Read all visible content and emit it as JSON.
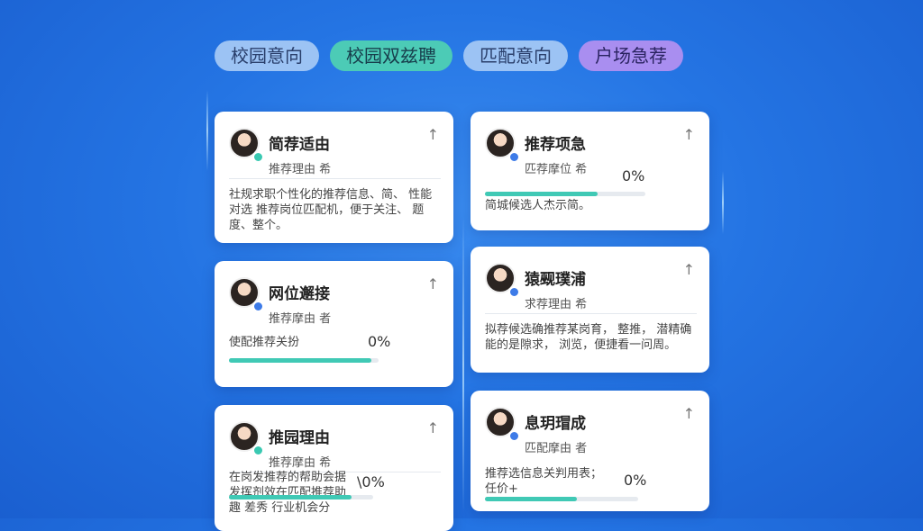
{
  "tabs": [
    {
      "label": "校园意向"
    },
    {
      "label": "校园双兹聘"
    },
    {
      "label": "匹配意向"
    },
    {
      "label": "户场急荐"
    }
  ],
  "cards": [
    {
      "title": "简荐适由",
      "sub": "推荐理由 希",
      "body": "社规求职个性化的推荐信息、简、 性能对选  推荐岗位匹配机，便于关注、 题度、整个。",
      "status_color": "#3ac9b2"
    },
    {
      "title": "推荐项急",
      "sub": "匹荐摩位 希",
      "pct": "0%",
      "progress": 0.7,
      "body": "简城候选人杰示简。",
      "status_color": "#3d7be8"
    },
    {
      "title": "网位邂接",
      "sub": "推荐摩由 者",
      "pct": "0%",
      "progress": 0.95,
      "body": "使配推荐关扮",
      "status_color": "#3d7be8"
    },
    {
      "title": "猿觋璞浦",
      "sub": "求荐理由 希",
      "body": "拟荐候选确推荐某岗育， 整推， 潜精确能的是隙求，  浏览，便捷看一问周。",
      "status_color": "#3d7be8"
    },
    {
      "title": "推园理由",
      "sub": "推荐摩由 希",
      "pct": "\\0%",
      "progress": 0.85,
      "body": "在岗发推荐的帮助会据 发挥剂效在匹配推荐助 趣  差秀 行业机会分",
      "status_color": "#3ac9b2"
    },
    {
      "title": "息玥瑁成",
      "sub": "匹配摩由 者",
      "pct": "0%",
      "progress": 0.6,
      "body": "推荐选信息关判用表； 任价+",
      "status_color": "#3d7be8"
    }
  ]
}
